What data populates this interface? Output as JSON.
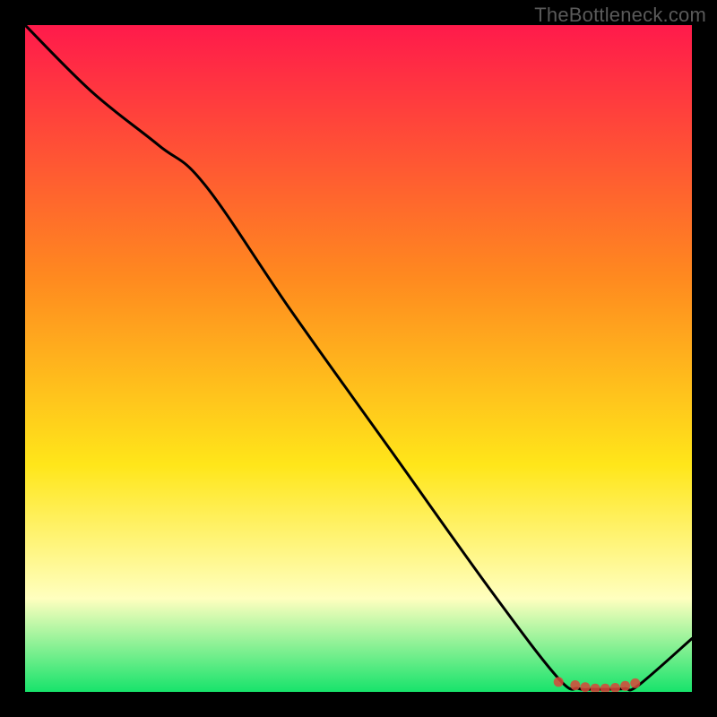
{
  "watermark": "TheBottleneck.com",
  "colors": {
    "frame": "#000000",
    "line": "#000000",
    "dot_fill": "#d9463a",
    "watermark": "#5a5a5a",
    "grad_top": "#ff1a4b",
    "grad_mid1": "#ff8a1f",
    "grad_mid2": "#ffe61a",
    "grad_mid3": "#ffffbf",
    "grad_bottom": "#17e36b"
  },
  "chart_data": {
    "type": "line",
    "title": "",
    "xlabel": "",
    "ylabel": "",
    "xlim": [
      0,
      100
    ],
    "ylim": [
      0,
      100
    ],
    "x": [
      0,
      10,
      20,
      27,
      40,
      55,
      70,
      80,
      83,
      85,
      88,
      90,
      92,
      100
    ],
    "y": [
      100,
      90,
      82,
      76,
      57,
      36,
      15,
      2,
      0.5,
      0.4,
      0.4,
      0.5,
      1,
      8
    ],
    "highlight_region": {
      "x_start": 80,
      "x_end": 92,
      "dots_x": [
        80,
        82.5,
        84,
        85.5,
        87,
        88.5,
        90,
        91.5
      ],
      "dots_y": [
        1.5,
        1.0,
        0.7,
        0.5,
        0.5,
        0.6,
        0.9,
        1.3
      ]
    },
    "annotations": []
  }
}
